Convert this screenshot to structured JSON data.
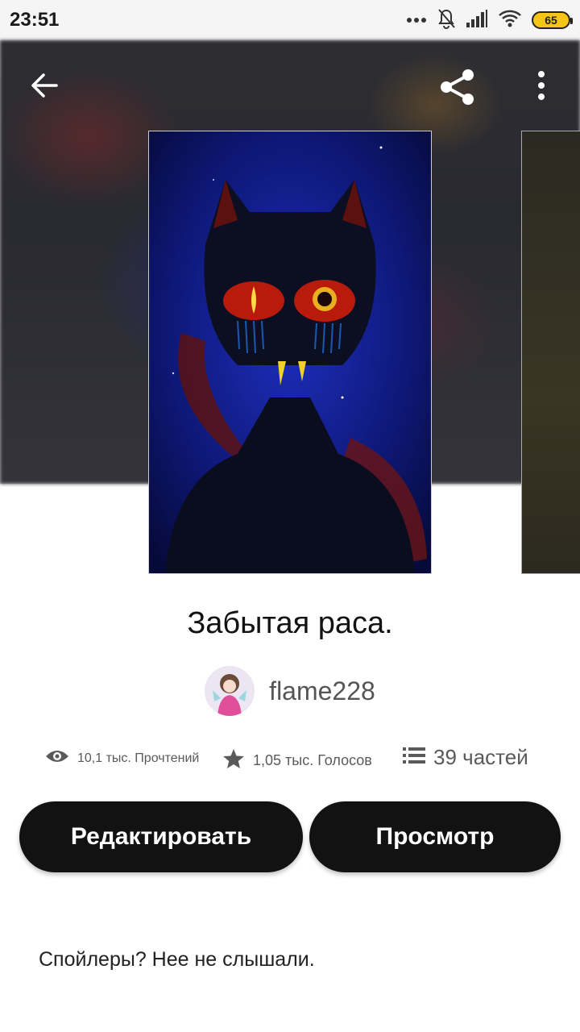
{
  "status_bar": {
    "time": "23:51",
    "battery": "65",
    "icons": [
      "dots-icon",
      "bell-off-icon",
      "signal-icon",
      "wifi-icon",
      "battery-icon"
    ]
  },
  "toolbar": {
    "icons": [
      "back-arrow-icon",
      "share-icon",
      "more-vert-icon"
    ]
  },
  "story": {
    "title": "Забытая раса.",
    "author": "flame228",
    "stats": {
      "reads": "10,1 тыс. Прочтений",
      "votes": "1,05 тыс. Голосов",
      "parts": "39 частей"
    },
    "description": "Спойлеры? Нее не слышали."
  },
  "actions": {
    "edit_label": "Редактировать",
    "view_label": "Просмотр"
  },
  "colors": {
    "button_bg": "#121212",
    "button_text": "#ffffff",
    "muted_text": "#5a5a5a"
  }
}
